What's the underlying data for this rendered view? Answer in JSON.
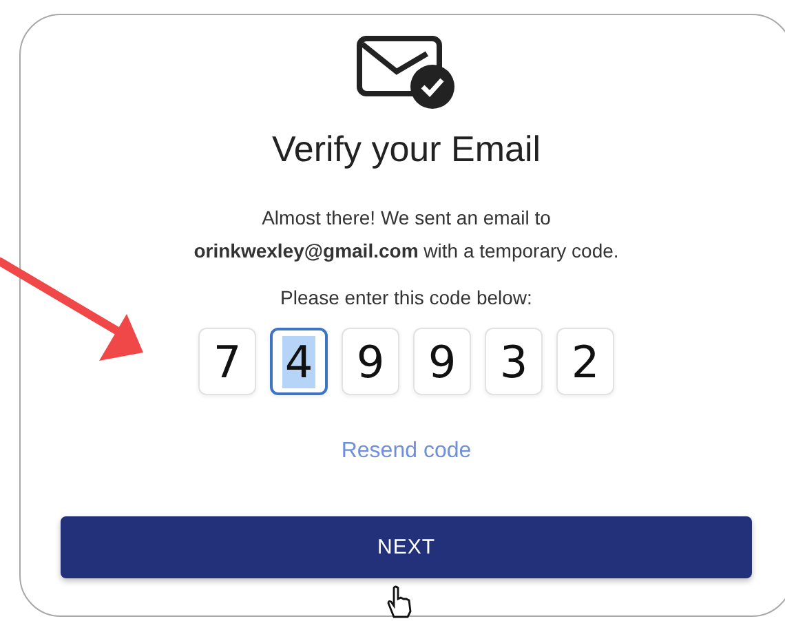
{
  "card": {
    "title": "Verify your Email",
    "message_line_1": "Almost there! We sent an email to",
    "message_line_2": "**orinkwexley@gmail.com** with a temporary code.",
    "prompt": "Please enter this code below:",
    "code_digits": [
      {
        "value": "7",
        "selected": false
      },
      {
        "value": "4",
        "selected": true
      },
      {
        "value": "9",
        "selected": false
      },
      {
        "value": "9",
        "selected": false
      },
      {
        "value": "3",
        "selected": false
      },
      {
        "value": "2",
        "selected": false
      }
    ],
    "resend_link": "Resend code",
    "next_button": "NEXT"
  }
}
